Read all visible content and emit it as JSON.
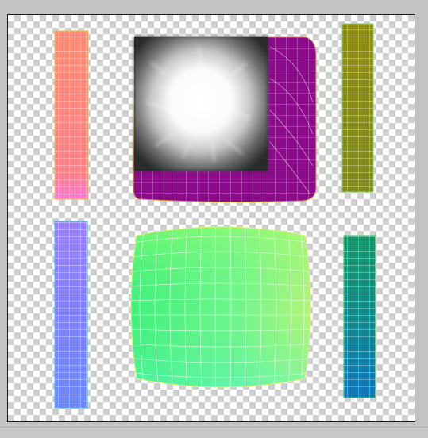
{
  "viewport": {
    "title": "",
    "islands": [
      {
        "name": "uv-island-red-strip",
        "color": "#ff8080"
      },
      {
        "name": "uv-island-magenta-panel",
        "color": "#8b0b8b"
      },
      {
        "name": "uv-island-olive-strip",
        "color": "#8b8b0b"
      },
      {
        "name": "uv-island-blue-strip",
        "color": "#8080ff"
      },
      {
        "name": "uv-island-green-panel",
        "color": "#6af58a"
      },
      {
        "name": "uv-island-teal-strip",
        "color": "#0b8b8b"
      }
    ],
    "texture": {
      "name": "ambient-occlusion-texture"
    }
  },
  "colors": {
    "background": "#c3c3c3",
    "checker_dark": "#cfcfcf",
    "checker_light": "#ffffff",
    "wire": "#ffffff"
  }
}
